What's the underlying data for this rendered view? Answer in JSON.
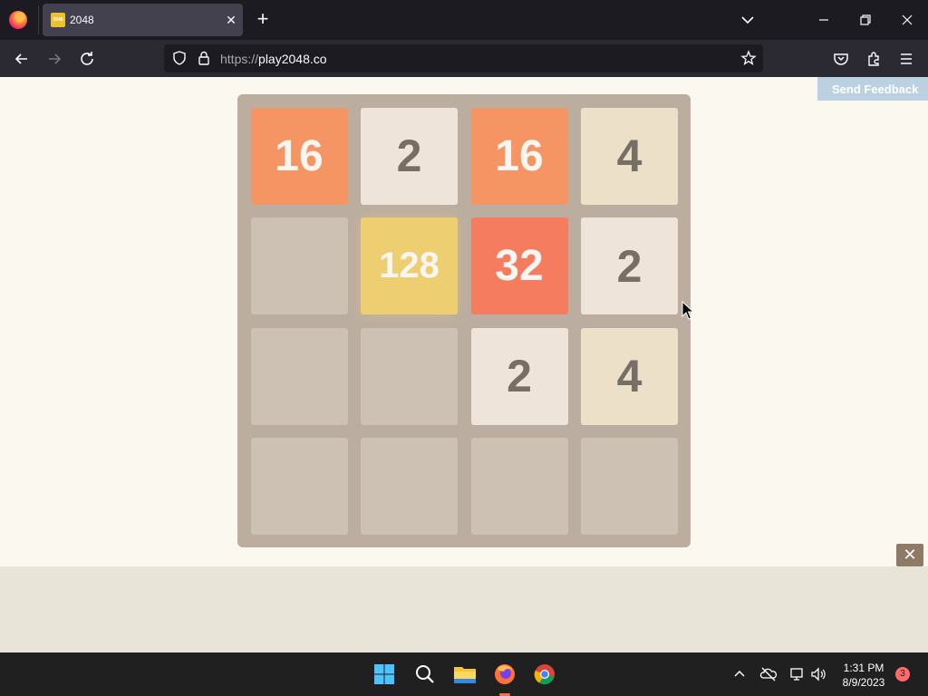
{
  "browser": {
    "tab": {
      "title": "2048",
      "favicon_text": "2048"
    },
    "url": {
      "protocol": "https://",
      "host": "play2048.co"
    }
  },
  "page": {
    "feedback_label": "Send Feedback",
    "board": [
      [
        "16",
        "2",
        "16",
        "4"
      ],
      [
        "",
        "128",
        "32",
        "2"
      ],
      [
        "",
        "",
        "2",
        "4"
      ],
      [
        "",
        "",
        "",
        ""
      ]
    ],
    "close_ad_label": "✕"
  },
  "taskbar": {
    "time": "1:31 PM",
    "date": "8/9/2023",
    "notification_count": "3"
  },
  "colors": {
    "tile_2": "#eee4da",
    "tile_4": "#ede0c8",
    "tile_16": "#f59563",
    "tile_32": "#f67c5f",
    "tile_128": "#edcf72",
    "board": "#bbada0",
    "empty_cell": "#cdc1b4"
  }
}
